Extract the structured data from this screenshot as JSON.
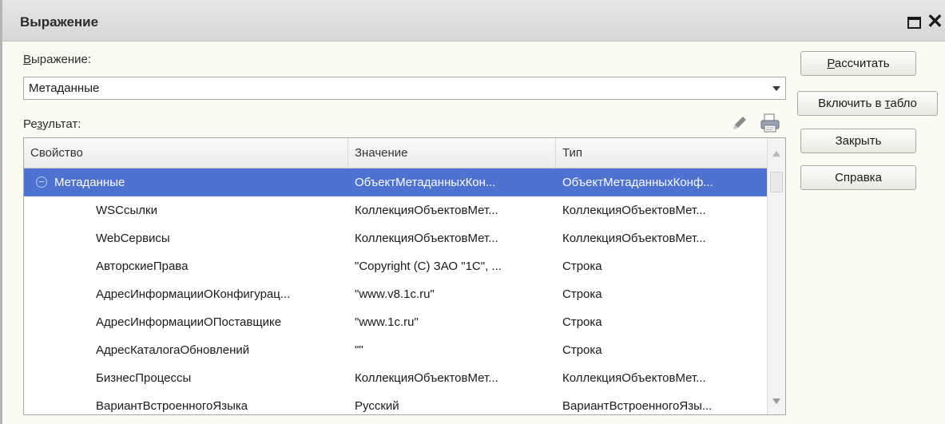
{
  "window": {
    "title": "Выражение"
  },
  "expression": {
    "label_first": "В",
    "label_rest": "ыражение:",
    "value": "Метаданные"
  },
  "result": {
    "label_a": "Ре",
    "label_u": "з",
    "label_b": "ультат:"
  },
  "grid": {
    "columns": [
      "Свойство",
      "Значение",
      "Тип"
    ],
    "rows": [
      {
        "property": "Метаданные",
        "value": "ОбъектМетаданныхКон...",
        "type": "ОбъектМетаданныхКонф...",
        "selected": true,
        "level": 0
      },
      {
        "property": "WSCсылки",
        "value": "КоллекцияОбъектовМет...",
        "type": "КоллекцияОбъектовМет...",
        "level": 1
      },
      {
        "property": "WebСервисы",
        "value": "КоллекцияОбъектовМет...",
        "type": "КоллекцияОбъектовМет...",
        "level": 1
      },
      {
        "property": "АвторскиеПрава",
        "value": "\"Copyright (C) ЗАО \"1С\", ...",
        "type": "Строка",
        "level": 1
      },
      {
        "property": "АдресИнформацииОКонфигурац...",
        "value": "\"www.v8.1c.ru\"",
        "type": "Строка",
        "level": 1
      },
      {
        "property": "АдресИнформацииОПоставщике",
        "value": "\"www.1c.ru\"",
        "type": "Строка",
        "level": 1
      },
      {
        "property": "АдресКаталогаОбновлений",
        "value": "\"\"",
        "type": "Строка",
        "level": 1
      },
      {
        "property": "БизнесПроцессы",
        "value": "КоллекцияОбъектовМет...",
        "type": "КоллекцияОбъектовМет...",
        "level": 1
      },
      {
        "property": "ВариантВстроенногоЯзыка",
        "value": "Русский",
        "type": "ВариантВстроенногоЯзы...",
        "level": 1
      }
    ]
  },
  "buttons": {
    "calculate_u": "Р",
    "calculate_rest": "ассчитать",
    "include_a": "Включить в ",
    "include_u": "т",
    "include_b": "абло",
    "close": "Закрыть",
    "help": "Справка"
  },
  "colors": {
    "selection": "#4e72d2",
    "title_bg": "#dedede",
    "window_bg": "#fbfbf3"
  },
  "icons": [
    "maximize-icon",
    "close-icon",
    "chevron-down-icon",
    "pencil-icon",
    "print-icon",
    "collapse-minus-icon",
    "scroll-up-icon",
    "scroll-down-icon"
  ]
}
